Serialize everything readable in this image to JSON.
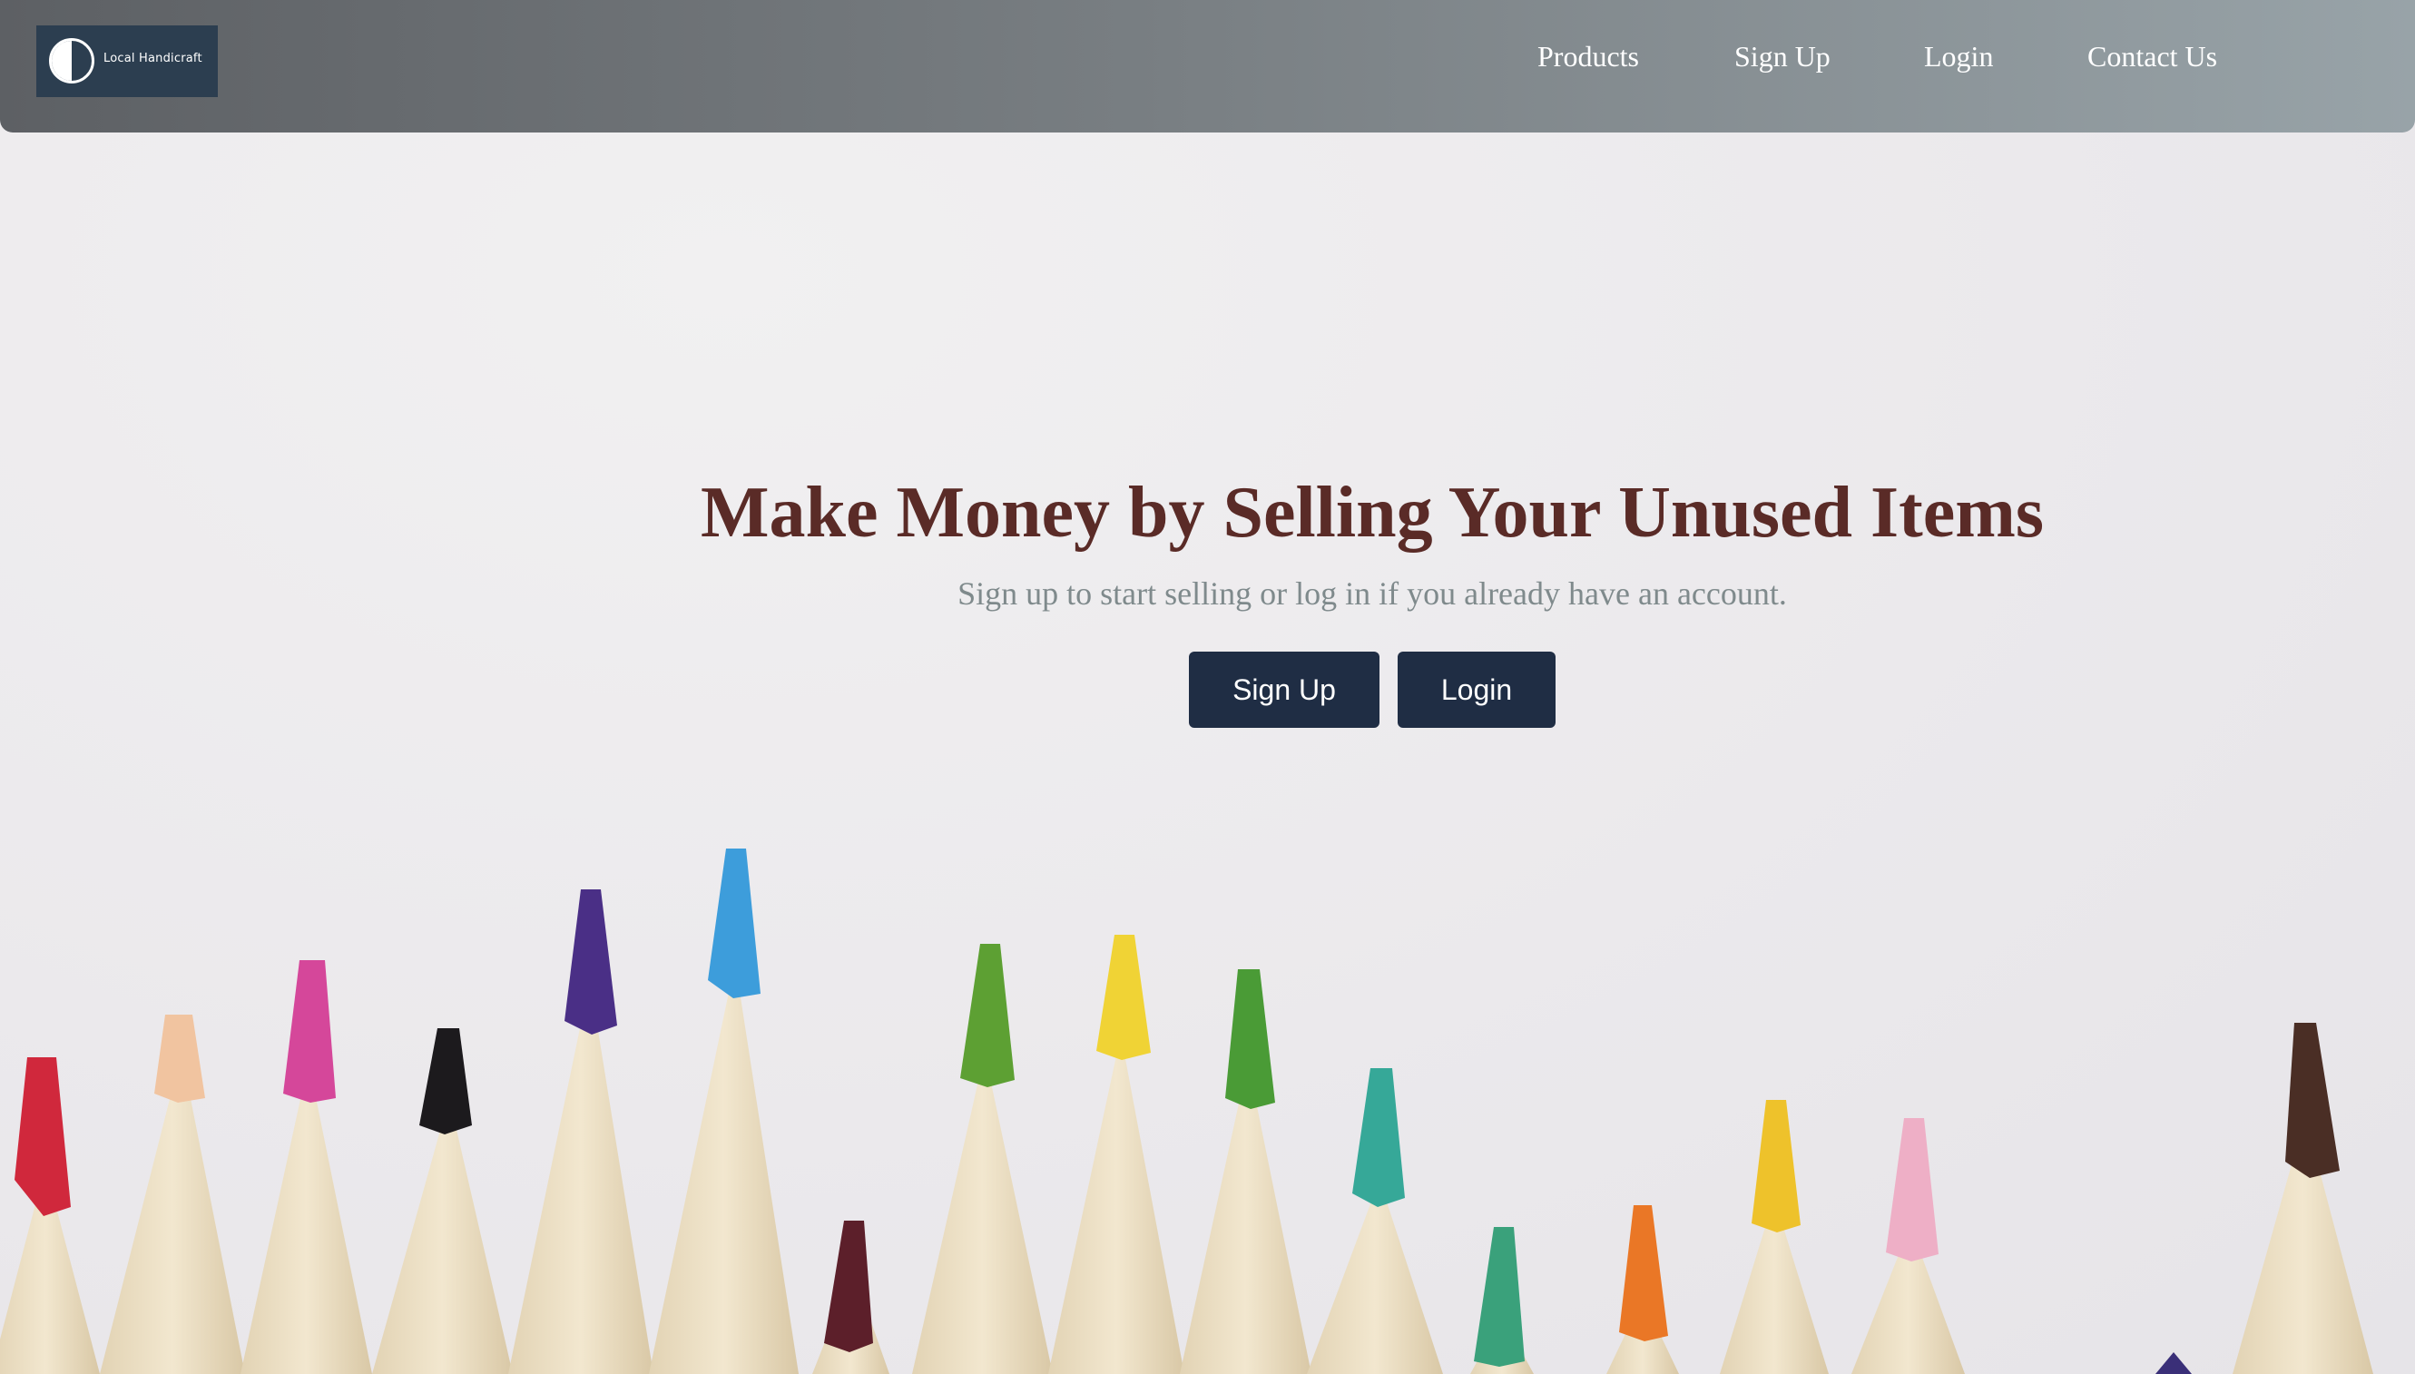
{
  "header": {
    "logo_text": "Local Handicraft",
    "nav": [
      {
        "label": "Products"
      },
      {
        "label": "Sign Up"
      },
      {
        "label": "Login"
      },
      {
        "label": "Contact Us"
      }
    ]
  },
  "hero": {
    "title": "Make Money by Selling Your Unused Items",
    "subtitle": "Sign up to start selling or log in if you already have an account.",
    "signup_label": "Sign Up",
    "login_label": "Login"
  },
  "colors": {
    "navbar_start": "#5d6064",
    "navbar_end": "#98a3a8",
    "title": "#5a2b27",
    "subtitle": "#7f8a8c",
    "button_bg": "#1f2d44",
    "logo_bg": "#2c3e50"
  },
  "icons": {
    "logo": "half-circle-logo-icon"
  }
}
